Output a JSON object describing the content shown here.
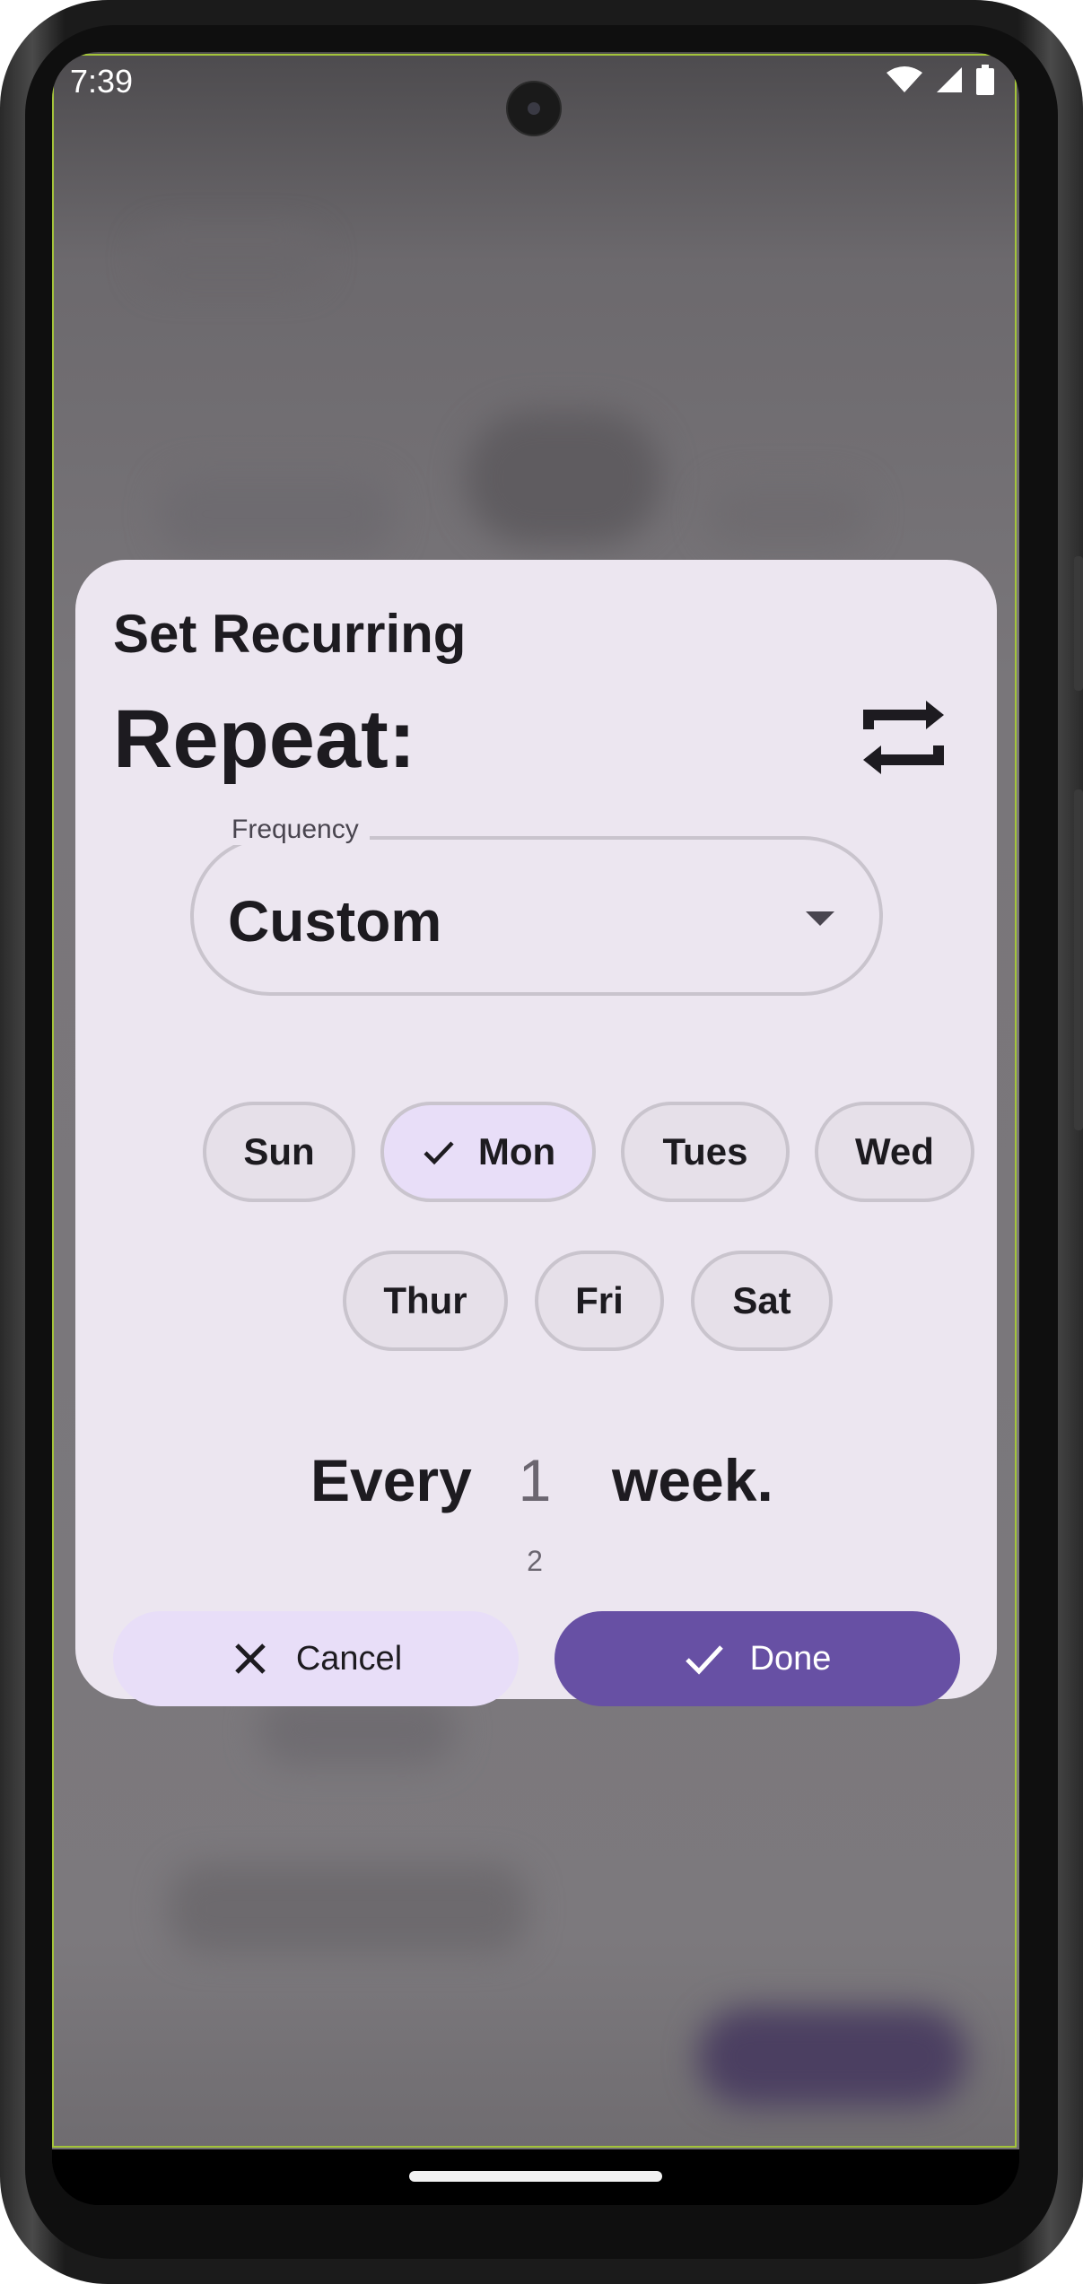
{
  "status_bar": {
    "time": "7:39",
    "icons": [
      "wifi-icon",
      "signal-icon",
      "battery-icon"
    ]
  },
  "dialog": {
    "title": "Set Recurring",
    "subtitle": "Repeat:",
    "header_icon": "repeat-icon",
    "frequency": {
      "label": "Frequency",
      "value": "Custom",
      "icon": "dropdown-arrow-icon"
    },
    "days": [
      {
        "label": "Sun",
        "selected": false
      },
      {
        "label": "Mon",
        "selected": true
      },
      {
        "label": "Tues",
        "selected": false
      },
      {
        "label": "Wed",
        "selected": false
      },
      {
        "label": "Thur",
        "selected": false
      },
      {
        "label": "Fri",
        "selected": false
      },
      {
        "label": "Sat",
        "selected": false
      }
    ],
    "interval": {
      "prefix": "Every",
      "current": "1",
      "next": "2",
      "unit": "week."
    },
    "cancel_label": "Cancel",
    "done_label": "Done"
  },
  "colors": {
    "dialog_bg": "#ece6f0",
    "primary": "#6750a4",
    "secondary_container": "#e8def8",
    "outline": "#c9c4cd",
    "highlight": "#a4c43a"
  }
}
